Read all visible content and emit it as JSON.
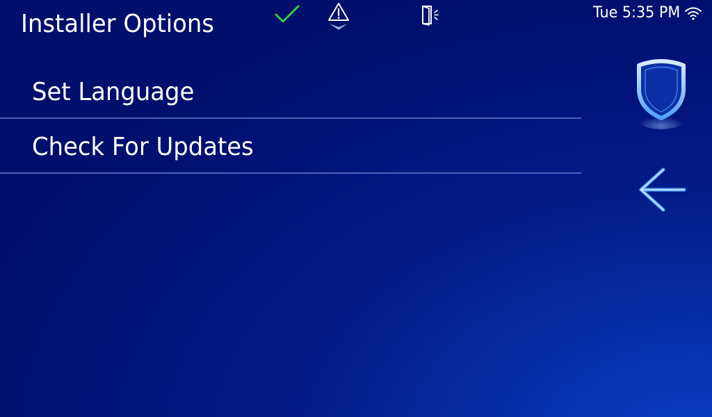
{
  "header": {
    "title": "Installer Options",
    "clock": "Tue 5:35 PM"
  },
  "status_icons": {
    "check": "check-icon",
    "alarm": "alarm-warning-icon",
    "door": "door-sensor-icon",
    "wifi": "wifi-icon"
  },
  "menu": {
    "items": [
      {
        "label": "Set Language"
      },
      {
        "label": "Check For Updates"
      }
    ]
  },
  "side_buttons": {
    "shield": "shield-icon",
    "back": "back-arrow-icon"
  },
  "colors": {
    "check": "#33d046",
    "accent_blue": "#5aa8ff",
    "divider": "#4c63b8"
  }
}
